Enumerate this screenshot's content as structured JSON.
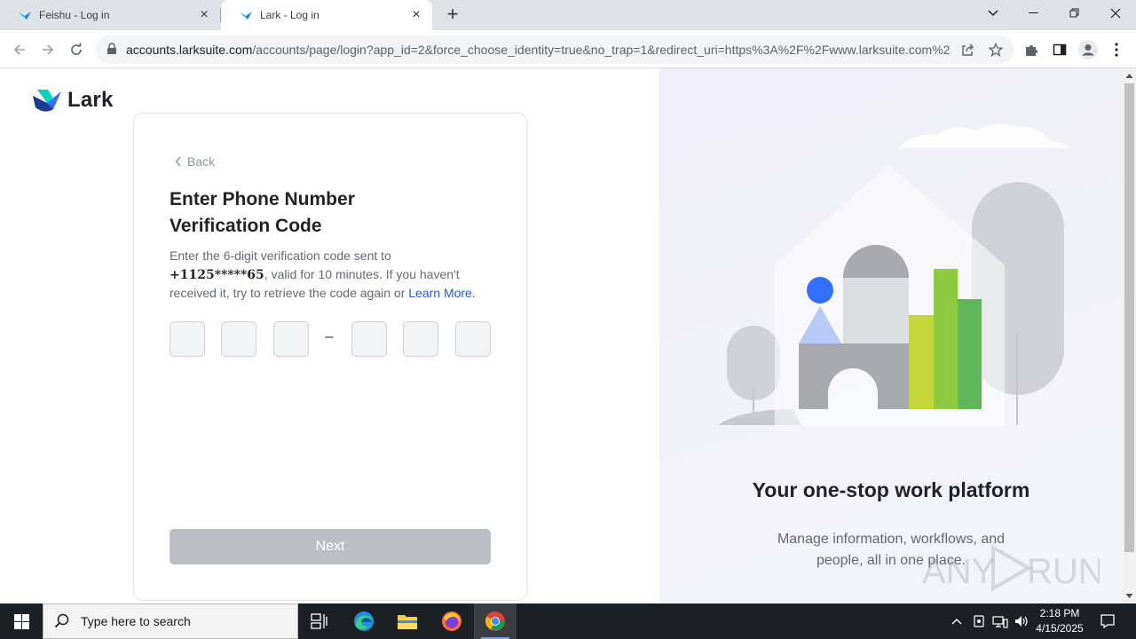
{
  "browser": {
    "tabs": [
      {
        "label": "Feishu - Log in"
      },
      {
        "label": "Lark - Log in"
      }
    ],
    "url_host": "accounts.larksuite.com",
    "url_path": "/accounts/page/login?app_id=2&force_choose_identity=true&no_trap=1&redirect_uri=https%3A%2F%2Fwww.larksuite.com%2..."
  },
  "page": {
    "logo_text": "Lark",
    "back_label": "Back",
    "title_line1": "Enter Phone Number",
    "title_line2": "Verification Code",
    "desc_prefix": "Enter the 6-digit verification code sent to",
    "phone": "+1125*****65",
    "desc_middle": ", valid for 10 minutes. If you haven't received it, try to retrieve the code again or ",
    "learn_more": "Learn More",
    "desc_suffix": ".",
    "code_dash": "–",
    "next_label": "Next",
    "headline": "Your one-stop work platform",
    "subline": "Manage information, workflows, and people, all in one place."
  },
  "taskbar": {
    "search_placeholder": "Type here to search",
    "time": "2:18 PM",
    "date": "4/15/2025"
  },
  "watermark": {
    "text_left": "ANY",
    "text_right": "RUN"
  },
  "colors": {
    "accent_link": "#245bdb",
    "next_disabled": "#bbbfc4",
    "taskbar": "#1c1f24"
  }
}
